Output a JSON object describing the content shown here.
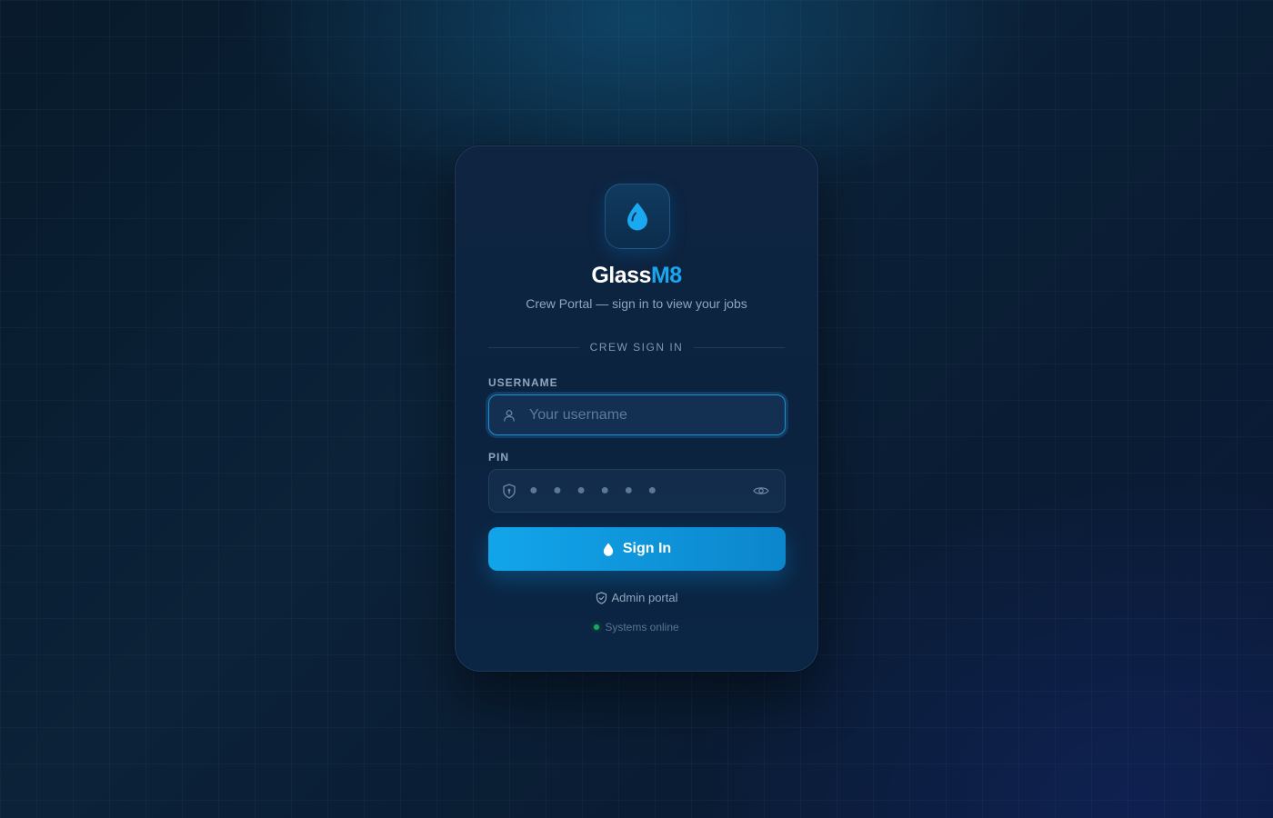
{
  "brand": {
    "name_primary": "Glass",
    "name_accent": "M8",
    "subtitle": "Crew Portal — sign in to view your jobs",
    "logo_icon": "water-drop-icon"
  },
  "form": {
    "section_title": "CREW SIGN IN",
    "username": {
      "label": "USERNAME",
      "placeholder": "Your username",
      "value": "",
      "icon": "user-icon"
    },
    "pin": {
      "label": "PIN",
      "placeholder_dots": "● ● ● ● ● ●",
      "value": "",
      "icon": "shield-icon",
      "toggle_icon": "eye-icon"
    },
    "submit_label": "Sign In"
  },
  "footer": {
    "admin_link": "Admin portal",
    "status_text": "Systems online"
  },
  "colors": {
    "accent": "#18a6ee",
    "button_start": "#12a5ea",
    "button_end": "#0c86cc",
    "status_ok": "#1fa65a",
    "background": "#0b2238"
  }
}
